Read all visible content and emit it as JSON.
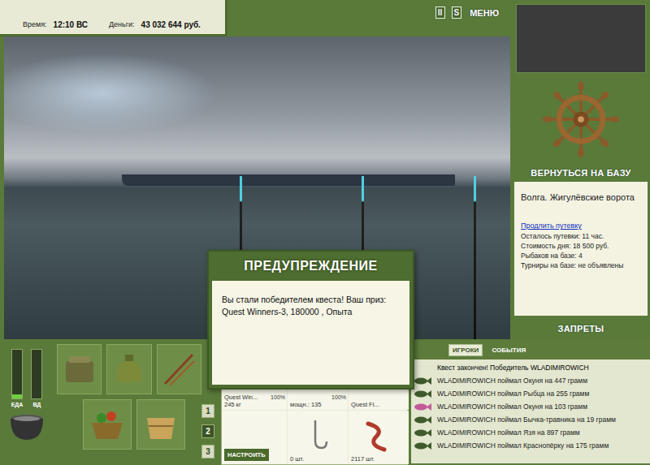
{
  "status": {
    "time_label": "Время:",
    "time": "12:10 ВС",
    "money_label": "Деньги:",
    "money": "43 032 644 руб."
  },
  "header_buttons": [
    {
      "label": "II"
    },
    {
      "label": "S"
    },
    {
      "label": "МЕНЮ"
    }
  ],
  "side": {
    "return_button": "ВЕРНУТЬСЯ НА БАЗУ",
    "location": "Волга. Жигулёвские ворота",
    "extend_link": "Продлить путевку",
    "info": [
      "Осталось путевки: 11 час.",
      "Стоимость дня: 18 500 руб.",
      "Рыбаков на базе: 4",
      "Турниры на базе: не объявлены"
    ],
    "bans_button": "ЗАПРЕТЫ"
  },
  "meters": [
    {
      "label": "ЕДА",
      "level": 0.08
    },
    {
      "label": "ВД",
      "level": 0
    }
  ],
  "slots": [
    {
      "label": "1",
      "selected": false
    },
    {
      "label": "2",
      "selected": true
    },
    {
      "label": "3",
      "selected": false
    }
  ],
  "tackle": {
    "rod": {
      "name": "Quest Win...",
      "load": "245 кг",
      "wear": "100%"
    },
    "items": [
      {
        "kind": "reel",
        "caption": "мощн.: 135",
        "wear": "100%"
      },
      {
        "kind": "line",
        "caption": "Quest Fi...",
        "wear": ""
      },
      {
        "kind": "hook",
        "caption": "0 шт.",
        "wear": ""
      },
      {
        "kind": "bait",
        "caption": "2117 шт.",
        "wear": ""
      }
    ],
    "setup_button": "НАСТРОИТЬ"
  },
  "dialog": {
    "title": "ПРЕДУПРЕЖДЕНИЕ",
    "message": "Вы стали победителем квеста! Ваш приз: Quest Winners-3, 180000 , Опыта"
  },
  "log_tabs": [
    {
      "label": "ИГРОКИ",
      "selected": true
    },
    {
      "label": "СОБЫТИЯ",
      "selected": false
    }
  ],
  "log": [
    {
      "kind": "notice",
      "text": "Квест закончен! Победитель WLADIMIROWICH",
      "color": "#000000"
    },
    {
      "kind": "catch",
      "text": "WLADIMIROWICH поймал Окуня на 447 грамм",
      "color": "#3f5a2c"
    },
    {
      "kind": "catch",
      "text": "WLADIMIROWICH поймал Рыбца на 255 грамм",
      "color": "#3f5a2c"
    },
    {
      "kind": "catch",
      "text": "WLADIMIROWICH поймал Окуня на 103 грамм",
      "color": "#c25a9a"
    },
    {
      "kind": "catch",
      "text": "WLADIMIROWICH поймал Бычка-травника на 19 грамм",
      "color": "#3f5a2c"
    },
    {
      "kind": "catch",
      "text": "WLADIMIROWICH поймал Язя на 897 грамм",
      "color": "#3f5a2c"
    },
    {
      "kind": "catch",
      "text": "WLADIMIROWICH поймал Краснопёрку на 175 грамм",
      "color": "#3f5a2c"
    }
  ]
}
